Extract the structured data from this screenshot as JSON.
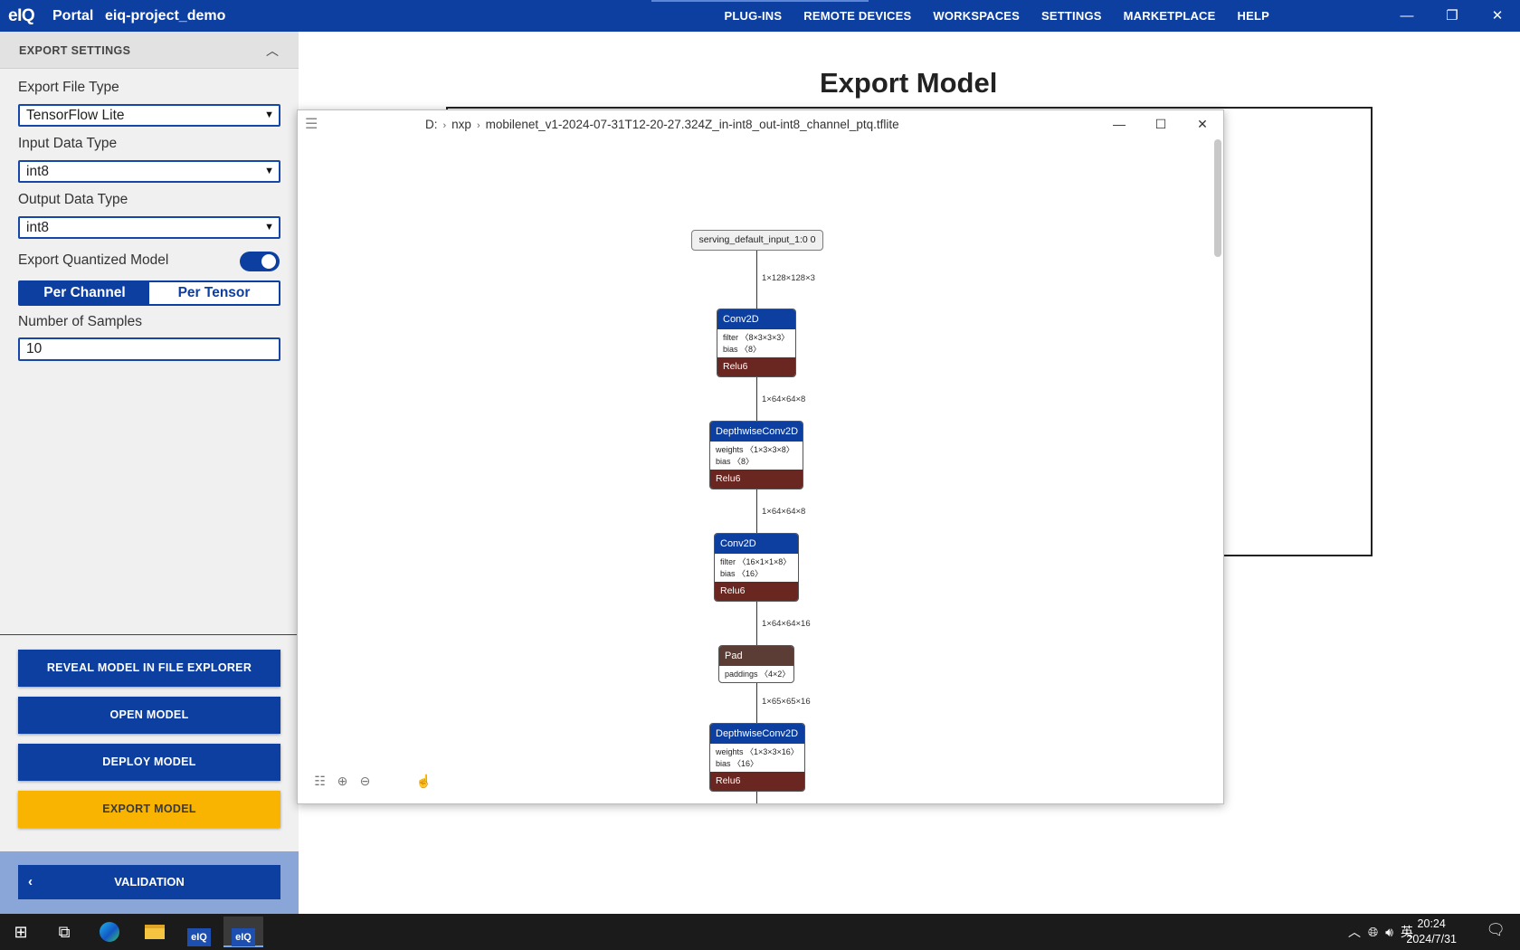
{
  "topbar": {
    "logo": "eIQ",
    "app_name": "Portal",
    "project_name": "eiq-project_demo",
    "nav": [
      "PLUG-INS",
      "REMOTE DEVICES",
      "WORKSPACES",
      "SETTINGS",
      "MARKETPLACE",
      "HELP"
    ],
    "window_controls": {
      "minimize": "—",
      "restore": "❐",
      "close": "✕"
    }
  },
  "sidebar": {
    "header": "EXPORT SETTINGS",
    "export_file_type": {
      "label": "Export File Type",
      "value": "TensorFlow Lite"
    },
    "input_data_type": {
      "label": "Input Data Type",
      "value": "int8"
    },
    "output_data_type": {
      "label": "Output Data Type",
      "value": "int8"
    },
    "export_quantized": {
      "label": "Export Quantized Model",
      "enabled": true
    },
    "quant_mode": {
      "options": [
        "Per Channel",
        "Per Tensor"
      ],
      "selected": "Per Channel"
    },
    "num_samples": {
      "label": "Number of Samples",
      "value": "10"
    },
    "actions": {
      "reveal": "REVEAL MODEL IN FILE EXPLORER",
      "open": "OPEN MODEL",
      "deploy": "DEPLOY MODEL",
      "export": "EXPORT MODEL"
    },
    "back": "VALIDATION"
  },
  "main": {
    "title": "Export Model"
  },
  "netron": {
    "breadcrumb": [
      "D:",
      "nxp",
      "mobilenet_v1-2024-07-31T12-20-27.324Z_in-int8_out-int8_channel_ptq.tflite"
    ],
    "input_node": "serving_default_input_1:0 0",
    "edges": [
      "1×128×128×3",
      "1×64×64×8",
      "1×64×64×8",
      "1×64×64×16",
      "1×65×65×16"
    ],
    "nodes": [
      {
        "op": "Conv2D",
        "attrs": [
          "filter 〈8×3×3×3〉",
          "bias 〈8〉"
        ],
        "activation": "Relu6"
      },
      {
        "op": "DepthwiseConv2D",
        "attrs": [
          "weights 〈1×3×3×8〉",
          "bias 〈8〉"
        ],
        "activation": "Relu6"
      },
      {
        "op": "Conv2D",
        "attrs": [
          "filter 〈16×1×1×8〉",
          "bias 〈16〉"
        ],
        "activation": "Relu6"
      },
      {
        "op": "Pad",
        "attrs": [
          "paddings 〈4×2〉"
        ],
        "activation": ""
      },
      {
        "op": "DepthwiseConv2D",
        "attrs": [
          "weights 〈1×3×3×16〉",
          "bias 〈16〉"
        ],
        "activation": "Relu6"
      }
    ]
  },
  "taskbar": {
    "tray_lang": "英",
    "time": "20:24",
    "date": "2024/7/31"
  }
}
